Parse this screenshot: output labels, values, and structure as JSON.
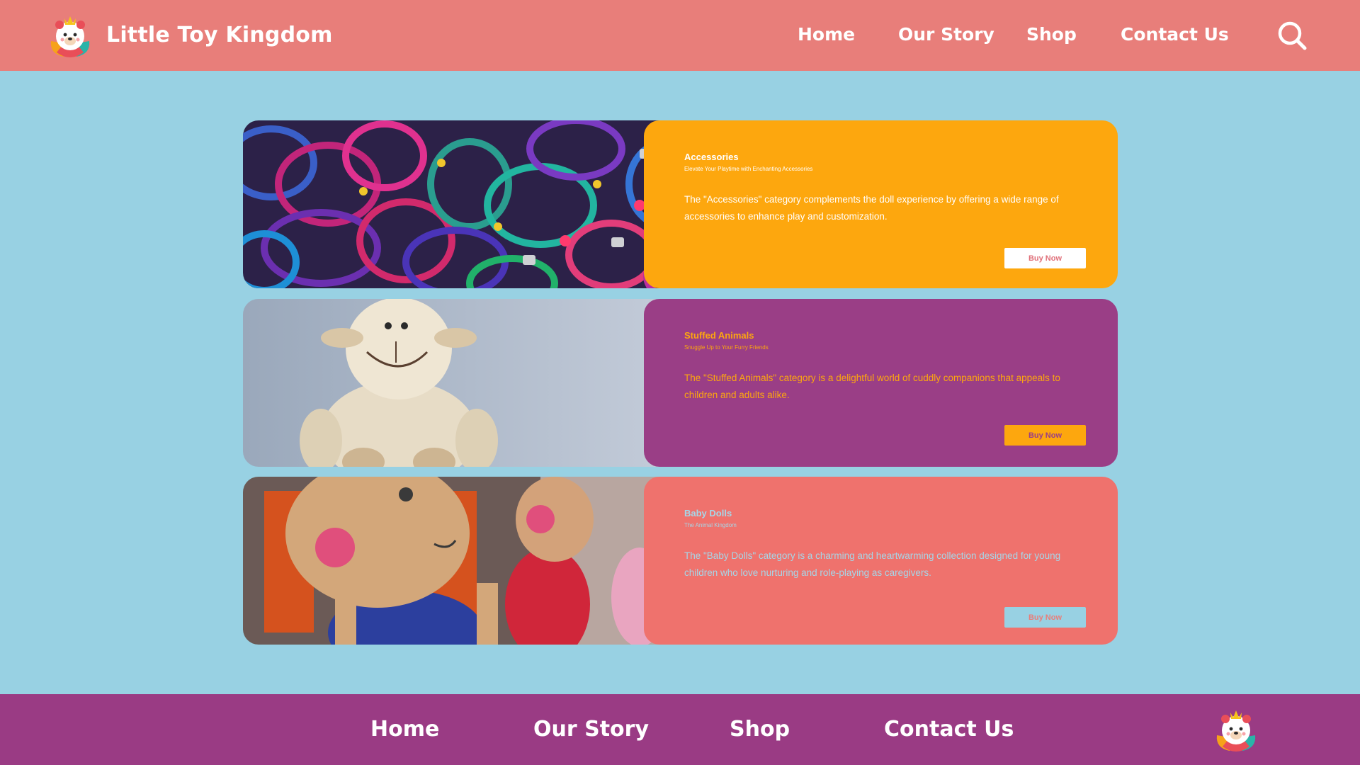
{
  "header": {
    "brand": "Little Toy Kingdom",
    "logo_icon": "bear-mascot-icon",
    "nav": [
      "Home",
      "Our Story",
      "Shop",
      "Contact Us"
    ],
    "search_icon": "search-icon",
    "bg_color": "#e87e7a"
  },
  "page": {
    "bg_color": "#98d1e3"
  },
  "cards": [
    {
      "title": "Accessories",
      "subtitle": "Elevate Your Playtime with Enchanting Accessories",
      "description": "The \"Accessories\" category complements the doll experience by offering a wide range of accessories to enhance play and customization.",
      "button": "Buy Now",
      "image": "colorful-bangles-photo",
      "panel_color": "#fda70e",
      "text_color": "#ffffff",
      "button_bg": "#ffffff",
      "button_color": "#e0707a"
    },
    {
      "title": "Stuffed Animals",
      "subtitle": "Snuggle Up to Your Furry Friends",
      "description": "The \"Stuffed Animals\" category is a delightful world of cuddly companions that appeals to children and adults alike.",
      "button": "Buy Now",
      "image": "plush-sheep-photo",
      "panel_color": "#9a3e86",
      "text_color": "#fda70e",
      "button_bg": "#fda70e",
      "button_color": "#9a3e86"
    },
    {
      "title": "Baby Dolls",
      "subtitle": "The Animal Kingdom",
      "description": "The \"Baby Dolls\" category is a charming and heartwarming collection designed for young children who love nurturing and role-playing as caregivers.",
      "button": "Buy Now",
      "image": "crochet-dolls-photo",
      "panel_color": "#ef726d",
      "text_color": "#a6d6e8",
      "button_bg": "#98d1e3",
      "button_color": "#e87e7a"
    }
  ],
  "footer": {
    "nav": [
      "Home",
      "Our Story",
      "Shop",
      "Contact Us"
    ],
    "logo_icon": "bear-mascot-icon",
    "bg_color": "#9a3b84"
  }
}
